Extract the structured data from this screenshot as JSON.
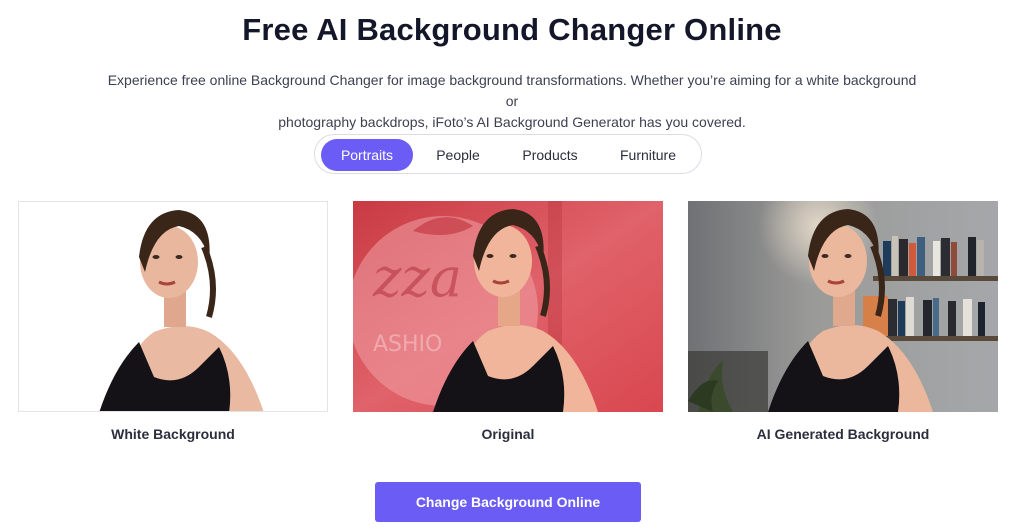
{
  "header": {
    "title": "Free AI Background Changer Online",
    "description_line1": "Experience free online Background Changer for image background transformations. Whether you’re aiming for a white background or",
    "description_line2": "photography backdrops, iFoto’s AI Background Generator has you covered."
  },
  "tabs": [
    {
      "label": "Portraits",
      "active": true
    },
    {
      "label": "People",
      "active": false
    },
    {
      "label": "Products",
      "active": false
    },
    {
      "label": "Furniture",
      "active": false
    }
  ],
  "gallery": [
    {
      "caption": "White Background"
    },
    {
      "caption": "Original"
    },
    {
      "caption": "AI Generated Background"
    }
  ],
  "cta": {
    "label": "Change Background Online"
  },
  "colors": {
    "accent": "#6b5cf6",
    "title": "#14172a",
    "original_bg": "#d9474f",
    "ai_bg": "#8a8c90"
  }
}
